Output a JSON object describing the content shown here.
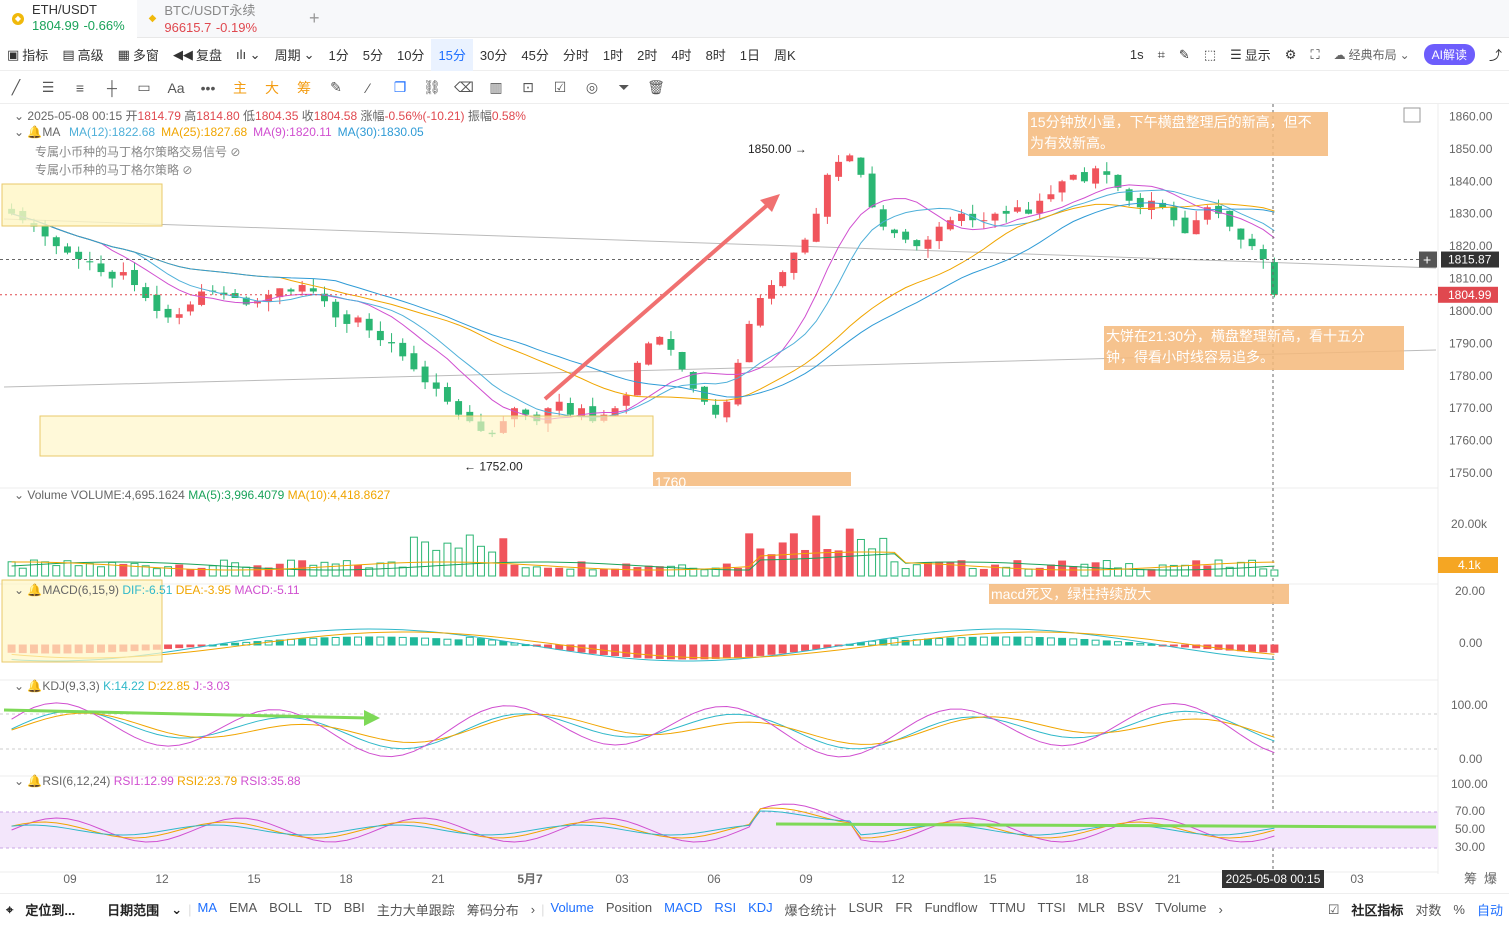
{
  "tabs": [
    {
      "symbol": "ETH/USDT",
      "price": "1804.99",
      "change": "-0.66%",
      "active": true
    },
    {
      "symbol": "BTC/USDT永续",
      "price": "96615.7",
      "change": "-0.19%",
      "active": false
    }
  ],
  "toolbar1": {
    "left": [
      "指标",
      "高级",
      "多窗",
      "复盘"
    ],
    "period_label": "周期",
    "intervals": [
      "1分",
      "5分",
      "10分",
      "15分",
      "30分",
      "45分",
      "分时",
      "1时",
      "2时",
      "4时",
      "8时",
      "1日",
      "周K"
    ],
    "selected_interval": "15分",
    "right_interval": "1s",
    "display": "显示",
    "layout": "经典布局",
    "ai": "AI解读"
  },
  "toolbar2": {
    "text_tool": "Aa",
    "labels": [
      "主",
      "大",
      "筹"
    ]
  },
  "ohlc": {
    "time": "2025-05-08 00:15",
    "open_label": "开",
    "open": "1814.79",
    "high_label": "高",
    "high": "1814.80",
    "low_label": "低",
    "low": "1804.35",
    "close_label": "收",
    "close": "1804.58",
    "chg_label": "涨幅",
    "chg": "-0.56%(-10.21)",
    "amp_label": "振幅",
    "amp": "0.58%"
  },
  "ma_legend": {
    "name": "MA",
    "items": [
      {
        "t": "MA(12):1822.68",
        "c": "#4fb0d9"
      },
      {
        "t": "MA(25):1827.68",
        "c": "#f0a500"
      },
      {
        "t": "MA(9):1820.11",
        "c": "#d04fd0"
      },
      {
        "t": "MA(30):1830.05",
        "c": "#2f9bd6"
      }
    ]
  },
  "strategies": [
    "专属小币种的马丁格尔策略交易信号",
    "专属小币种的马丁格尔策略"
  ],
  "price_axis": {
    "ticks": [
      "1860.00",
      "1850.00",
      "1840.00",
      "1830.00",
      "1820.00",
      "1810.00",
      "1800.00",
      "1790.00",
      "1780.00",
      "1770.00",
      "1760.00",
      "1750.00"
    ],
    "cross_label": "1815.87",
    "last_label": "1804.99",
    "min": 1746,
    "max": 1862
  },
  "markers": {
    "high": "1850.00 →",
    "low": "← 1752.00"
  },
  "annotations": [
    {
      "text": "15分钟放小量，下午横盘整理后的新高，但不为有效新高。"
    },
    {
      "text": "大饼在21:30分，横盘整理新高，看十五分钟，得看小时线容易追多。"
    },
    {
      "text": "1760"
    },
    {
      "text": "macd死叉，绿柱持续放大"
    }
  ],
  "volume": {
    "legend_name": "Volume",
    "vol": "VOLUME:4,695.1624",
    "ma5": "MA(5):3,996.4079",
    "ma10": "MA(10):4,418.8627",
    "axis_top": "20.00k",
    "last_label": "4.1k"
  },
  "macd": {
    "legend_name": "MACD(6,15,9)",
    "dif": "DIF:-6.51",
    "dea": "DEA:-3.95",
    "macd": "MACD:-5.11",
    "axis": [
      "20.00",
      "0.00"
    ]
  },
  "kdj": {
    "legend_name": "KDJ(9,3,3)",
    "k": "K:14.22",
    "d": "D:22.85",
    "j": "J:-3.03",
    "axis": [
      "100.00",
      "0.00"
    ]
  },
  "rsi": {
    "legend_name": "RSI(6,12,24)",
    "r1": "RSI1:12.99",
    "r2": "RSI2:23.79",
    "r3": "RSI3:35.88",
    "axis": [
      "100.00",
      "70.00",
      "50.00",
      "30.00"
    ]
  },
  "time_axis": {
    "labels": [
      "09",
      "12",
      "15",
      "18",
      "21",
      "5月7",
      "03",
      "06",
      "09",
      "12",
      "15",
      "18",
      "21",
      "03"
    ],
    "cursor": "2025-05-08 00:15",
    "right": [
      "筹",
      "爆"
    ]
  },
  "footer": {
    "left": [
      "定位到...",
      "日期范围"
    ],
    "main_ind": [
      "MA",
      "EMA",
      "BOLL",
      "TD",
      "BBI",
      "主力大单跟踪",
      "筹码分布"
    ],
    "sub_ind": [
      "Volume",
      "Position",
      "MACD",
      "RSI",
      "KDJ",
      "爆仓统计",
      "LSUR",
      "FR",
      "Fundflow",
      "TTMU",
      "TTSI",
      "MLR",
      "BSV",
      "TVolume"
    ],
    "right": [
      "社区指标",
      "对数",
      "%",
      "自动"
    ]
  },
  "chart_data": {
    "type": "candlestick",
    "interval": "15分",
    "candles_close": [
      1830,
      1828,
      1826,
      1823,
      1820,
      1818,
      1816,
      1815,
      1812,
      1810,
      1812,
      1808,
      1804,
      1800,
      1798,
      1799,
      1802,
      1806,
      1806,
      1805,
      1804,
      1802,
      1803,
      1805,
      1807,
      1806,
      1808,
      1806,
      1803,
      1798,
      1796,
      1798,
      1794,
      1791,
      1790,
      1786,
      1782,
      1778,
      1776,
      1772,
      1768,
      1766,
      1763,
      1762,
      1766,
      1770,
      1768,
      1766,
      1770,
      1772,
      1768,
      1770,
      1766,
      1768,
      1770,
      1774,
      1784,
      1790,
      1792,
      1788,
      1782,
      1776,
      1772,
      1768,
      1772,
      1784,
      1796,
      1804,
      1808,
      1812,
      1818,
      1822,
      1830,
      1842,
      1846,
      1848,
      1842,
      1832,
      1826,
      1824,
      1822,
      1820,
      1822,
      1826,
      1828,
      1830,
      1828,
      1828,
      1830,
      1830,
      1832,
      1830,
      1834,
      1836,
      1840,
      1842,
      1840,
      1844,
      1842,
      1838,
      1834,
      1832,
      1834,
      1832,
      1828,
      1824,
      1828,
      1832,
      1830,
      1826,
      1822,
      1820,
      1816,
      1805
    ],
    "price_range": [
      1746,
      1862
    ],
    "annotated_high": 1850.0,
    "annotated_low": 1752.0,
    "cursor_price": 1815.87,
    "last_price": 1804.99
  }
}
